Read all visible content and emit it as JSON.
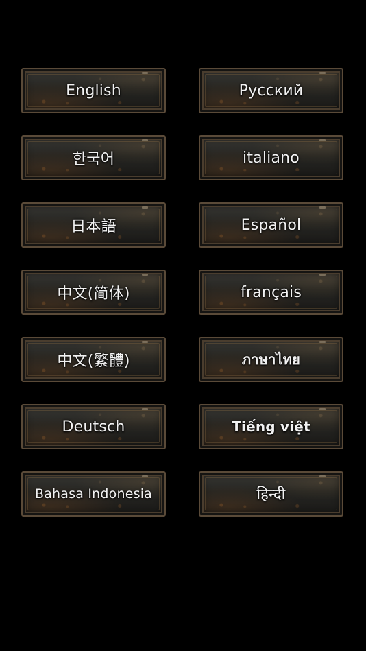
{
  "languages": [
    {
      "label": "English"
    },
    {
      "label": "Русский"
    },
    {
      "label": "한국어"
    },
    {
      "label": "italiano"
    },
    {
      "label": "日本語"
    },
    {
      "label": "Español"
    },
    {
      "label": "中文(简体)"
    },
    {
      "label": "français"
    },
    {
      "label": "中文(繁體)"
    },
    {
      "label": "ภาษาไทย"
    },
    {
      "label": "Deutsch"
    },
    {
      "label": "Tiếng việt"
    },
    {
      "label": "Bahasa Indonesia"
    },
    {
      "label": "हिन्दी"
    }
  ],
  "colors": {
    "background": "#000000",
    "button_text": "#f2f2f2",
    "button_border": "#5a4a38"
  }
}
